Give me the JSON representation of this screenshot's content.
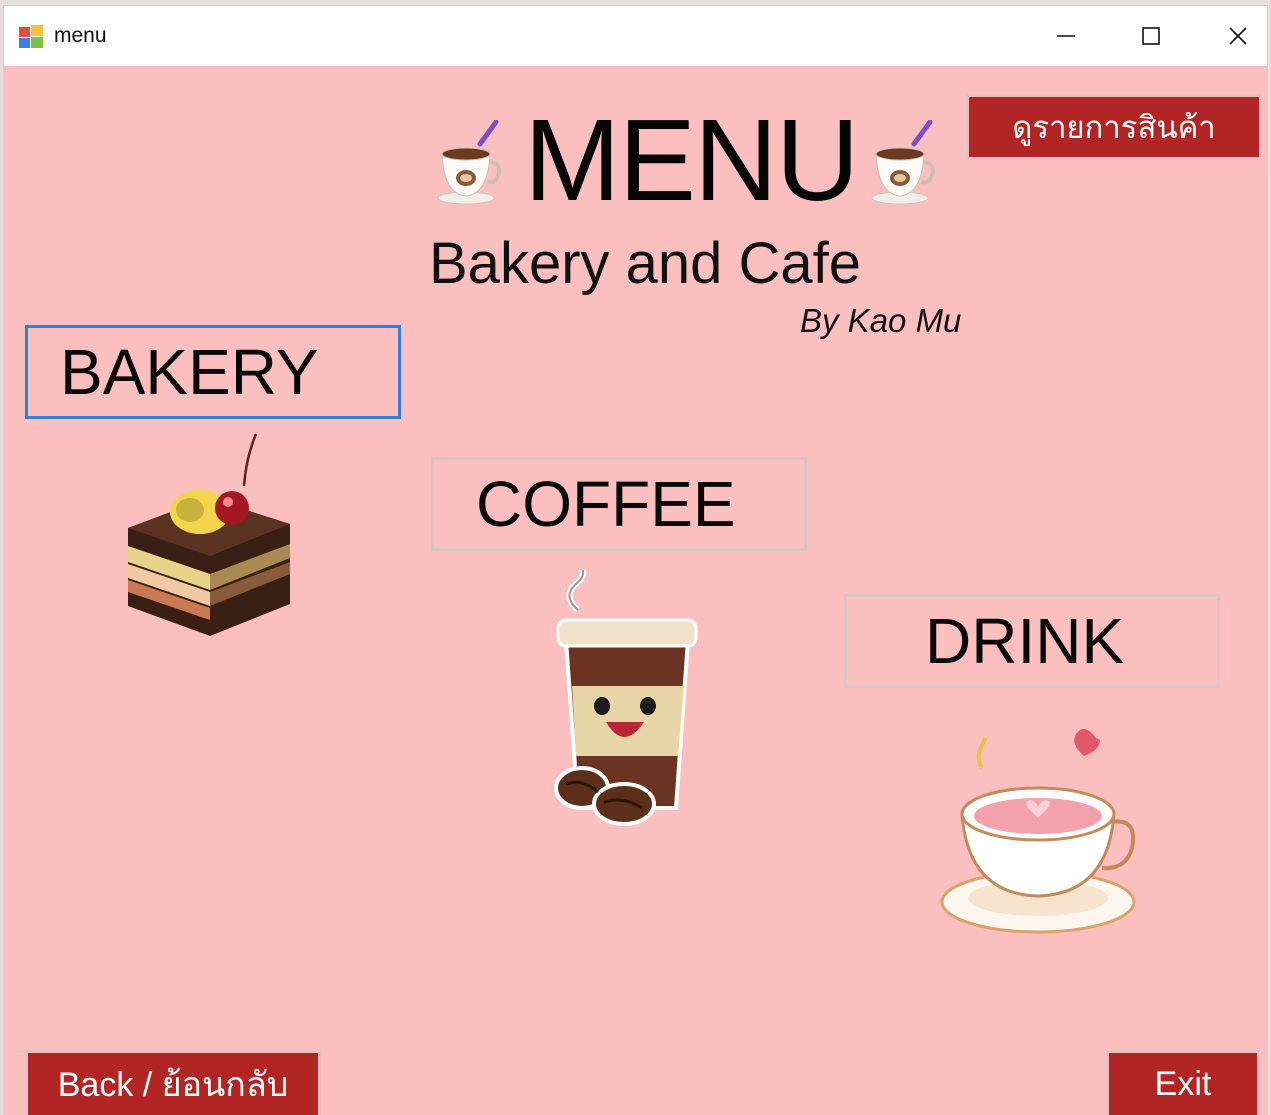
{
  "window": {
    "title": "menu"
  },
  "header": {
    "title": "MENU",
    "subtitle": "Bakery and Cafe",
    "author": "By Kao Mu"
  },
  "buttons": {
    "product_list": "ดูรายการสินค้า",
    "back": "Back / ย้อนกลับ",
    "exit": "Exit"
  },
  "categories": {
    "bakery": "BAKERY",
    "coffee": "COFFEE",
    "drink": "DRINK"
  },
  "icons": {
    "app": "app-icon",
    "minimize": "minimize-icon",
    "maximize": "maximize-icon",
    "close": "close-icon",
    "header_cup": "coffee-cup-icon",
    "bakery": "cake-icon",
    "coffee": "coffee-cup-character-icon",
    "drink": "tea-cup-icon"
  },
  "colors": {
    "background": "#fbbfbf",
    "accent_button": "#b22525",
    "selected_outline": "#2f80d6"
  }
}
